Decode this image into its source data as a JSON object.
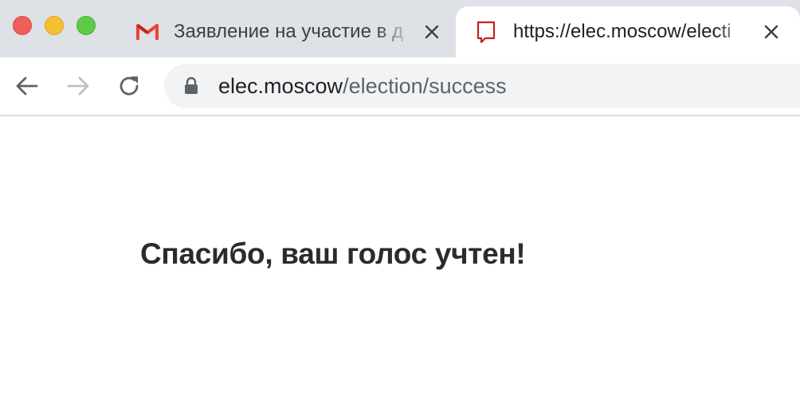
{
  "window": {
    "controls": [
      "close",
      "minimize",
      "maximize"
    ]
  },
  "tabs": [
    {
      "title": "Заявление на участие в д",
      "icon": "gmail-icon",
      "active": false
    },
    {
      "title": "https://elec.moscow/electi",
      "icon": "page-bookmark-icon",
      "active": true
    }
  ],
  "toolbar": {
    "back_icon": "arrow-left-icon",
    "forward_icon": "arrow-right-icon",
    "reload_icon": "reload-icon"
  },
  "address_bar": {
    "security_icon": "lock-icon",
    "host": "elec.moscow",
    "path": "/election/success"
  },
  "page": {
    "message": "Спасибо, ваш голос учтен!"
  },
  "colors": {
    "tabbar_bg": "#dee1e6",
    "omnibox_bg": "#f1f3f4",
    "gmail_red": "#ea4335",
    "favicon_red": "#c5221f"
  }
}
